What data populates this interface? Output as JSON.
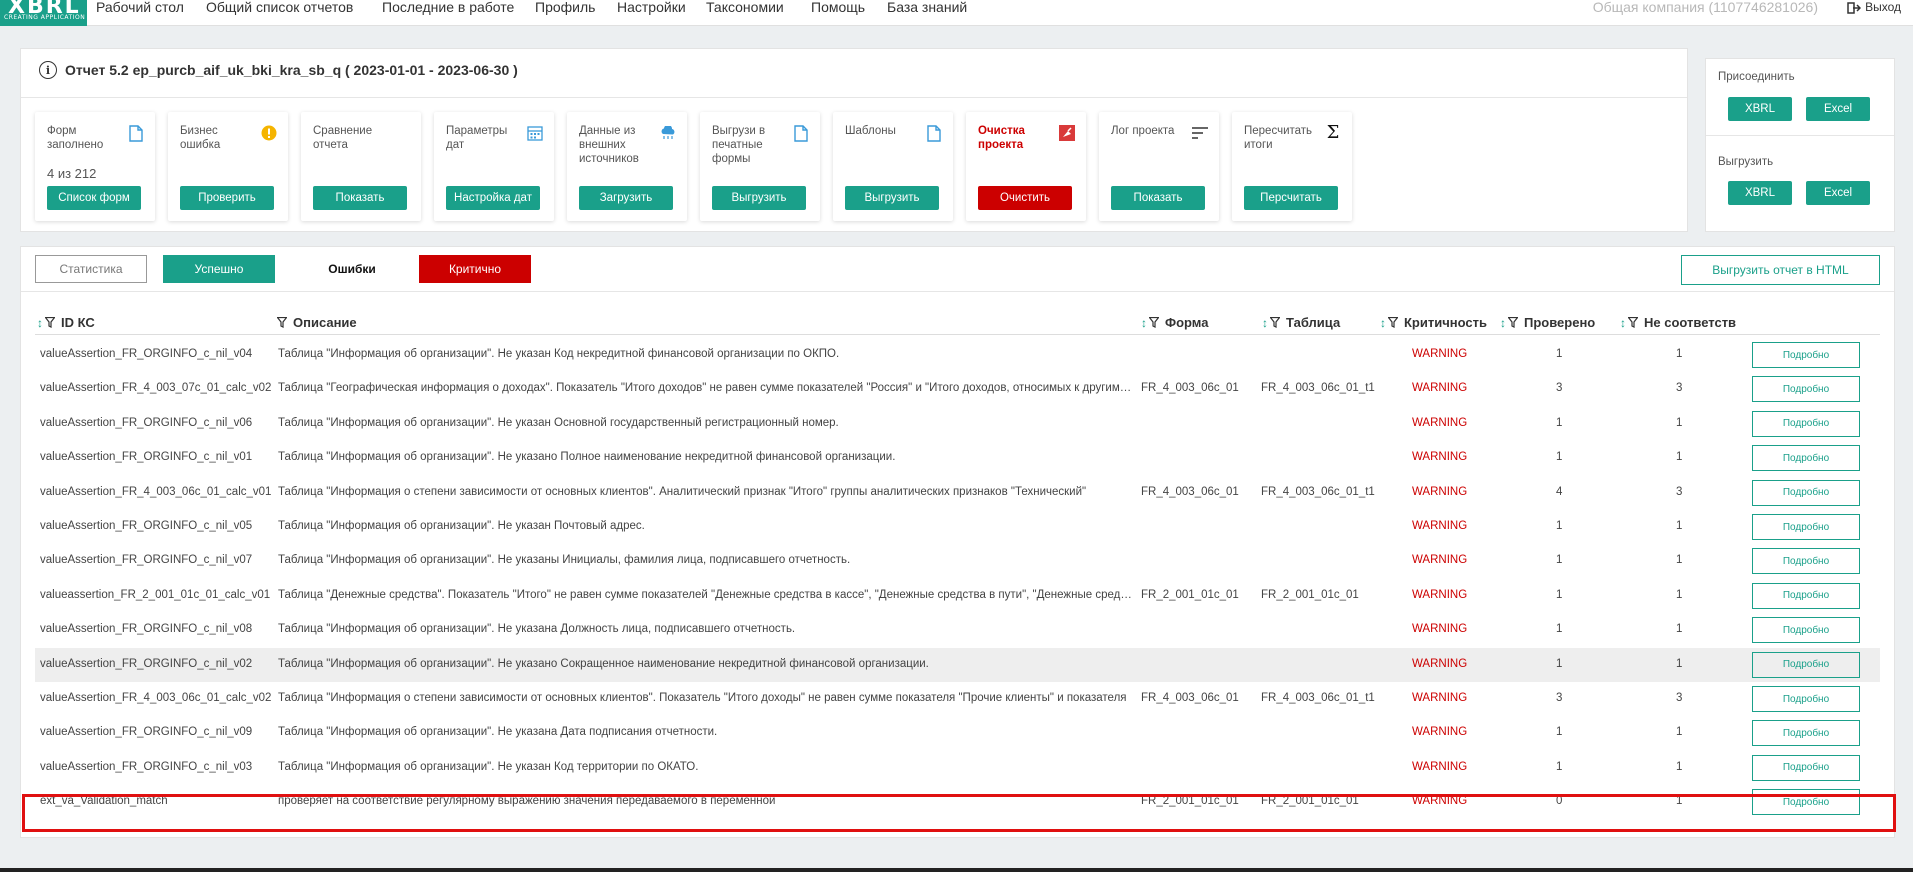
{
  "nav": {
    "logo_main": "XBRL",
    "logo_sub": "CREATING APPLICATION",
    "items": [
      "Рабочий стол",
      "Общий список отчетов",
      "Последние в работе",
      "Профиль",
      "Настройки",
      "Таксономии",
      "Помощь",
      "База знаний"
    ],
    "company": "Общая компания (1107746281026)",
    "logout": "Выход"
  },
  "report": {
    "title": "Отчет 5.2 ep_purcb_aif_uk_bki_kra_sb_q ( 2023-01-01 - 2023-06-30 )",
    "cards": [
      {
        "title": "Форм заполнено",
        "count": "4 из 212",
        "button": "Список форм",
        "icon": "file-icon"
      },
      {
        "title": "Бизнес ошибка",
        "count": "",
        "button": "Проверить",
        "icon": "warning-icon"
      },
      {
        "title": "Сравнение отчета",
        "count": "",
        "button": "Показать",
        "icon": ""
      },
      {
        "title": "Параметры дат",
        "count": "",
        "button": "Настройка дат",
        "icon": "calendar-icon"
      },
      {
        "title": "Данные из внешних источников",
        "count": "",
        "button": "Загрузить",
        "icon": "cloud-icon"
      },
      {
        "title": "Выгрузи в печатные формы",
        "count": "",
        "button": "Выгрузить",
        "icon": "file-icon"
      },
      {
        "title": "Шаблоны",
        "count": "",
        "button": "Выгрузить",
        "icon": "file-icon"
      },
      {
        "title": "Очистка проекта",
        "count": "",
        "button": "Очистить",
        "icon": "clear-icon"
      },
      {
        "title": "Лог проекта",
        "count": "",
        "button": "Показать",
        "icon": "list-icon"
      },
      {
        "title": "Пересчитать итоги",
        "count": "",
        "button": "Персчитать",
        "icon": "sigma-icon"
      }
    ]
  },
  "side": {
    "attach_label": "Присоединить",
    "export_label": "Выгрузить",
    "xbrl": "XBRL",
    "excel": "Excel"
  },
  "filters": {
    "stat": "Статистика",
    "ok": "Успешно",
    "errors": "Ошибки",
    "critical": "Критично",
    "export_html": "Выгрузить отчет в HTML"
  },
  "table": {
    "headers": [
      "ID КС",
      "Описание",
      "Форма",
      "Таблица",
      "Критичность",
      "Проверено",
      "Не соответств"
    ],
    "detail_label": "Подробно",
    "rows": [
      {
        "id": "valueAssertion_FR_ORGINFO_c_nil_v04",
        "desc": "Таблица \"Информация об организации\". Не указан Код некредитной финансовой организации по ОКПО.",
        "form": "",
        "table": "",
        "crit": "WARNING",
        "checked": "1",
        "fail": "1"
      },
      {
        "id": "valueAssertion_FR_4_003_07c_01_calc_v02",
        "desc": "Таблица \"Географическая информация о доходах\". Показатель \"Итого доходов\" не равен сумме показателей \"Россия\" и \"Итого доходов, относимых к другим странам\"",
        "form": "FR_4_003_06c_01",
        "table": "FR_4_003_06c_01_t1",
        "crit": "WARNING",
        "checked": "3",
        "fail": "3"
      },
      {
        "id": "valueAssertion_FR_ORGINFO_c_nil_v06",
        "desc": "Таблица \"Информация об организации\". Не указан Основной государственный регистрационный номер.",
        "form": "",
        "table": "",
        "crit": "WARNING",
        "checked": "1",
        "fail": "1"
      },
      {
        "id": "valueAssertion_FR_ORGINFO_c_nil_v01",
        "desc": "Таблица \"Информация об организации\". Не указано Полное наименование некредитной финансовой организации.",
        "form": "",
        "table": "",
        "crit": "WARNING",
        "checked": "1",
        "fail": "1"
      },
      {
        "id": "valueAssertion_FR_4_003_06c_01_calc_v01",
        "desc": "Таблица \"Информация о степени зависимости от основных клиентов\". Аналитический признак \"Итого\" группы аналитических признаков \"Технический\"",
        "form": "FR_4_003_06c_01",
        "table": "FR_4_003_06c_01_t1",
        "crit": "WARNING",
        "checked": "4",
        "fail": "3"
      },
      {
        "id": "valueAssertion_FR_ORGINFO_c_nil_v05",
        "desc": "Таблица \"Информация об организации\". Не указан Почтовый адрес.",
        "form": "",
        "table": "",
        "crit": "WARNING",
        "checked": "1",
        "fail": "1"
      },
      {
        "id": "valueAssertion_FR_ORGINFO_c_nil_v07",
        "desc": "Таблица \"Информация об организации\". Не указаны Инициалы, фамилия лица, подписавшего отчетность.",
        "form": "",
        "table": "",
        "crit": "WARNING",
        "checked": "1",
        "fail": "1"
      },
      {
        "id": "valueassertion_FR_2_001_01c_01_calc_v01",
        "desc": "Таблица \"Денежные средства\". Показатель \"Итого\" не равен сумме показателей \"Денежные средства в кассе\", \"Денежные средства в пути\", \"Денежные средства\"",
        "form": "FR_2_001_01c_01",
        "table": "FR_2_001_01c_01",
        "crit": "WARNING",
        "checked": "1",
        "fail": "1"
      },
      {
        "id": "valueAssertion_FR_ORGINFO_c_nil_v08",
        "desc": "Таблица \"Информация об организации\". Не указана Должность лица, подписавшего отчетность.",
        "form": "",
        "table": "",
        "crit": "WARNING",
        "checked": "1",
        "fail": "1"
      },
      {
        "id": "valueAssertion_FR_ORGINFO_c_nil_v02",
        "desc": "Таблица \"Информация об организации\". Не указано Сокращенное наименование некредитной финансовой организации.",
        "form": "",
        "table": "",
        "crit": "WARNING",
        "checked": "1",
        "fail": "1"
      },
      {
        "id": "valueAssertion_FR_4_003_06c_01_calc_v02",
        "desc": "Таблица \"Информация о степени зависимости от основных клиентов\". Показатель \"Итого доходы\" не равен сумме показателя \"Прочие клиенты\" и показателя",
        "form": "FR_4_003_06c_01",
        "table": "FR_4_003_06c_01_t1",
        "crit": "WARNING",
        "checked": "3",
        "fail": "3"
      },
      {
        "id": "valueAssertion_FR_ORGINFO_c_nil_v09",
        "desc": "Таблица \"Информация об организации\". Не указана Дата подписания отчетности.",
        "form": "",
        "table": "",
        "crit": "WARNING",
        "checked": "1",
        "fail": "1"
      },
      {
        "id": "valueAssertion_FR_ORGINFO_c_nil_v03",
        "desc": "Таблица \"Информация об организации\". Не указан Код территории по ОКАТО.",
        "form": "",
        "table": "",
        "crit": "WARNING",
        "checked": "1",
        "fail": "1"
      },
      {
        "id": "ext_va_Validation_match",
        "desc": "проверяет на соответствие регулярному выражению значения передаваемого в переменной",
        "form": "FR_2_001_01c_01",
        "table": "FR_2_001_01c_01",
        "crit": "WARNING",
        "checked": "0",
        "fail": "1"
      }
    ]
  }
}
